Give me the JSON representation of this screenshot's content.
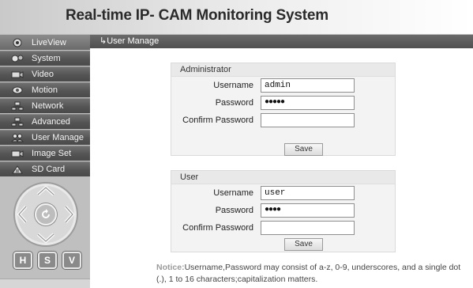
{
  "app": {
    "title": "Real-time IP- CAM Monitoring System"
  },
  "sidebar": {
    "items": [
      {
        "label": "LiveView",
        "icon": "liveview-icon",
        "active": true
      },
      {
        "label": "System",
        "icon": "system-icon"
      },
      {
        "label": "Video",
        "icon": "video-icon"
      },
      {
        "label": "Motion",
        "icon": "motion-icon"
      },
      {
        "label": "Network",
        "icon": "network-icon"
      },
      {
        "label": "Advanced",
        "icon": "advanced-icon"
      },
      {
        "label": "User Manage",
        "icon": "users-icon"
      },
      {
        "label": "Image Set",
        "icon": "image-set-icon"
      },
      {
        "label": "SD Card",
        "icon": "sd-card-icon"
      }
    ],
    "ptz": {
      "center_icon": "refresh-icon"
    },
    "mode_buttons": [
      {
        "label": "H"
      },
      {
        "label": "S"
      },
      {
        "label": "V"
      }
    ]
  },
  "header": {
    "breadcrumb": "↳User Manage"
  },
  "admin": {
    "title": "Administrator",
    "username_label": "Username",
    "username_value": "admin",
    "password_label": "Password",
    "password_mask": "●●●●●",
    "confirm_label": "Confirm Password",
    "confirm_value": "",
    "save_label": "Save"
  },
  "user": {
    "title": "User",
    "username_label": "Username",
    "username_value": "user",
    "password_label": "Password",
    "password_mask": "●●●●",
    "confirm_label": "Confirm Password",
    "confirm_value": "",
    "save_label": "Save"
  },
  "notice": {
    "label": "Notice:",
    "text": "Username,Password may consist of a-z, 0-9, underscores, and a single dot (.), 1 to 16 characters;capitalization matters."
  },
  "colors": {
    "menu_bg": "#545454",
    "header_strip": "#5a5a5a",
    "panel_bg": "#f3f3f3",
    "notice_label": "#9a9a9a"
  }
}
